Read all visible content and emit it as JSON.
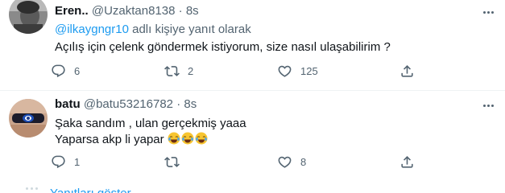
{
  "tweets": [
    {
      "display_name": "Eren..",
      "handle": "@Uzaktan8138",
      "separator": "·",
      "time": "8s",
      "replying_mention": "@ilkaygngr10",
      "replying_suffix": " adlı kişiye yanıt olarak",
      "text_lines": [
        "Açılış için çelenk göndermek istiyorum, size nasıl ulaşabilirim ?"
      ],
      "reply_count": "6",
      "retweet_count": "2",
      "like_count": "125"
    },
    {
      "display_name": "batu",
      "handle": "@batu53216782",
      "separator": "·",
      "time": "8s",
      "text_lines": [
        "Şaka sandım , ulan gerçekmiş yaaa",
        "Yaparsa akp li yapar "
      ],
      "emoji": [
        "face-with-tears-of-joy",
        "face-with-tears-of-joy",
        "face-with-tears-of-joy"
      ],
      "reply_count": "1",
      "retweet_count": "",
      "like_count": "8"
    }
  ],
  "show_replies": "Yanıtları göster",
  "colors": {
    "accent": "#1d9bf0",
    "muted": "#536471",
    "text": "#0f1419",
    "divider": "#eff3f4"
  }
}
